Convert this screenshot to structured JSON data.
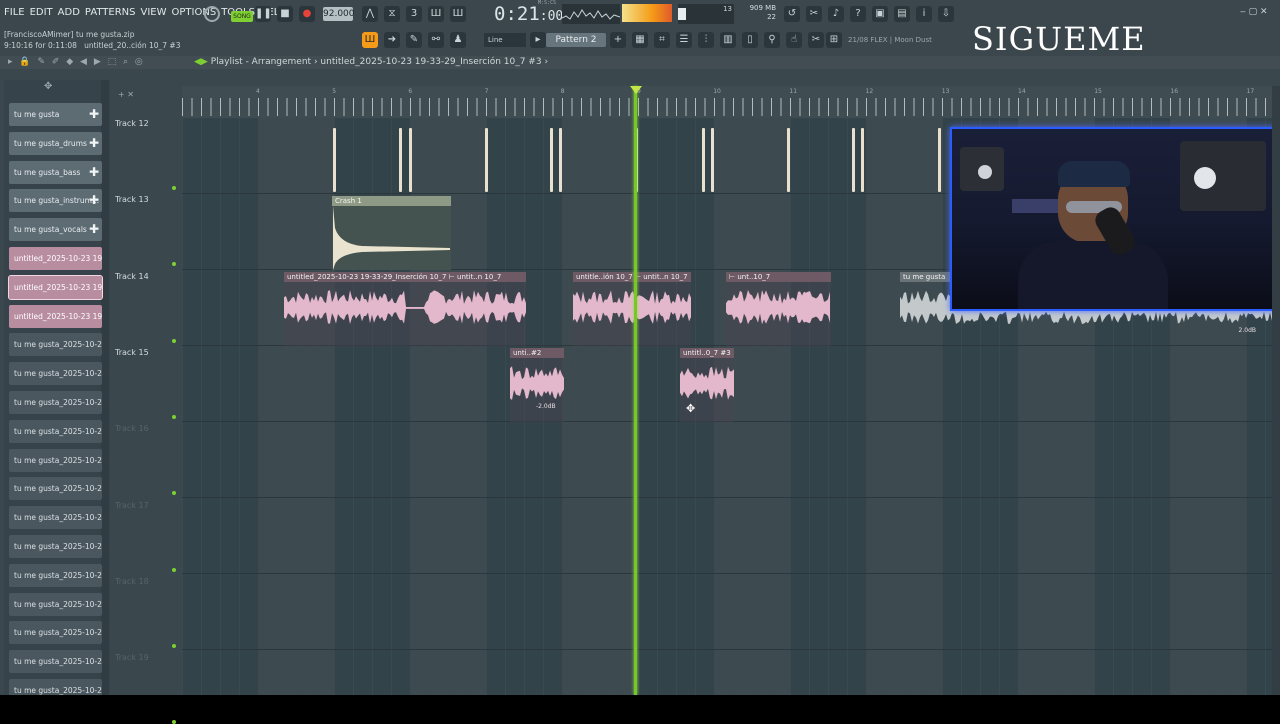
{
  "menu": [
    "FILE",
    "EDIT",
    "ADD",
    "PATTERNS",
    "VIEW",
    "OPTIONS",
    "TOOLS",
    "HELP"
  ],
  "status": {
    "line1": "[FranciscoAMimer] tu me gusta.zip",
    "line2": "9:10:16 for 0:11:08",
    "line2b": "untitled_20..ción 10_7 #3"
  },
  "transport": {
    "song_label": "SONG",
    "tempo": "92.000",
    "time": "0:21",
    "time_sub": ":00",
    "time_unit": "M:S:CS",
    "mem_mb": "909 MB",
    "voices": "13",
    "cpu": "22"
  },
  "pattern_selector": "Pattern 2",
  "snap": "Line",
  "hint_text": "21/08 FLEX | Moon Dust",
  "overlay_text": "SIGUEME",
  "playlist": {
    "title": "Playlist - Arrangement",
    "breadcrumb": "untitled_2025-10-23 19-33-29_Inserción 10_7 #3"
  },
  "channels": [
    {
      "label": "tu me gusta",
      "style": "normal",
      "plus": true
    },
    {
      "label": "tu me gusta_drums",
      "style": "normal",
      "plus": true
    },
    {
      "label": "tu me gusta_bass",
      "style": "normal",
      "plus": true
    },
    {
      "label": "tu me gusta_instrum...",
      "style": "normal",
      "plus": true
    },
    {
      "label": "tu me gusta_vocals",
      "style": "normal",
      "plus": true
    },
    {
      "label": "untitled_2025-10-23 19-...",
      "style": "pink",
      "plus": false
    },
    {
      "label": "untitled_2025-10-23 19-...",
      "style": "pink sel",
      "plus": false
    },
    {
      "label": "untitled_2025-10-23 19-...",
      "style": "pink",
      "plus": false
    },
    {
      "label": "tu me gusta_2025-10-23...",
      "style": "dark",
      "plus": false
    },
    {
      "label": "tu me gusta_2025-10-23...",
      "style": "dark",
      "plus": false
    },
    {
      "label": "tu me gusta_2025-10-23...",
      "style": "dark",
      "plus": false
    },
    {
      "label": "tu me gusta_2025-10-23...",
      "style": "dark",
      "plus": false
    },
    {
      "label": "tu me gusta_2025-10-23...",
      "style": "dark",
      "plus": false
    },
    {
      "label": "tu me gusta_2025-10-23...",
      "style": "dark",
      "plus": false
    },
    {
      "label": "tu me gusta_2025-10-23...",
      "style": "dark",
      "plus": false
    },
    {
      "label": "tu me gusta_2025-10-23...",
      "style": "dark",
      "plus": false
    },
    {
      "label": "tu me gusta_2025-10-23...",
      "style": "dark",
      "plus": false
    },
    {
      "label": "tu me gusta_2025-10-23...",
      "style": "dark",
      "plus": false
    },
    {
      "label": "tu me gusta_2025-10-23...",
      "style": "dark",
      "plus": false
    },
    {
      "label": "tu me gusta_2025-10-23...",
      "style": "dark",
      "plus": false
    },
    {
      "label": "tu me gusta_2025-10-23...",
      "style": "dark",
      "plus": false
    }
  ],
  "tracks": [
    {
      "name": "Track 12",
      "dim": false
    },
    {
      "name": "Track 13",
      "dim": false
    },
    {
      "name": "Track 14",
      "dim": false
    },
    {
      "name": "Track 15",
      "dim": false
    },
    {
      "name": "Track 16",
      "dim": true
    },
    {
      "name": "Track 17",
      "dim": true
    },
    {
      "name": "Track 18",
      "dim": true
    },
    {
      "name": "Track 19",
      "dim": true
    }
  ],
  "bar_numbers": [
    "4",
    "5",
    "6",
    "7",
    "8",
    "9",
    "10",
    "11",
    "12",
    "13",
    "14",
    "15",
    "16",
    "17"
  ],
  "clips": {
    "crash": "Crash 1",
    "t14_a": "untitled_2025-10-23 19-33-29_Inserción 10_7 ⊢ untit..n 10_7",
    "t14_b": "untitle..ión 10_7 ⊢ untit..n 10_7",
    "t14_c": "⊢ unt..10_7",
    "t14_d": "tu me gusta",
    "t15_a": "unti..#2",
    "t15_b": "untitl..0_7 #3",
    "db_a": "-2.0dB",
    "db_b": "2.0dB"
  }
}
